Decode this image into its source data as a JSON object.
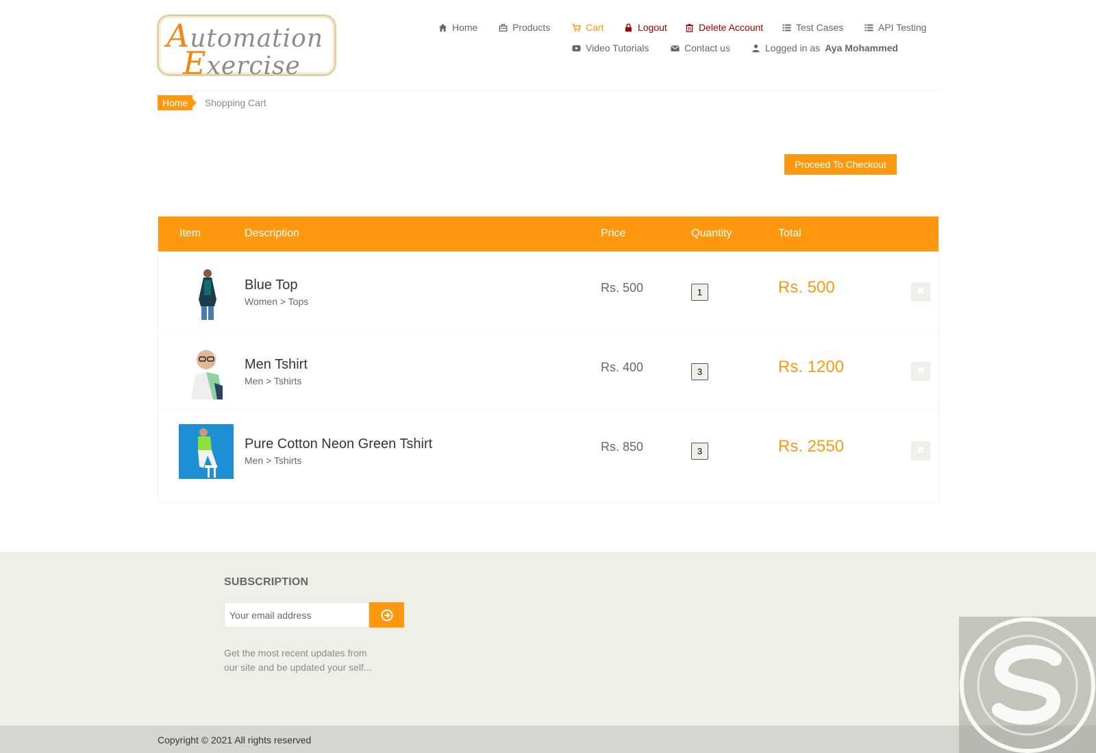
{
  "logo": {
    "line1_cap": "A",
    "line1_rest": "utomation",
    "line2_cap": "E",
    "line2_rest": "xercise"
  },
  "nav": {
    "home": "Home",
    "products": "Products",
    "cart": "Cart",
    "logout": "Logout",
    "delete_account": "Delete Account",
    "test_cases": "Test Cases",
    "api_testing": "API Testing",
    "video_tutorials": "Video Tutorials",
    "contact_us": "Contact us",
    "logged_in_prefix": "Logged in as",
    "logged_in_user": "Aya Mohammed"
  },
  "breadcrumb": {
    "home": "Home",
    "current": "Shopping Cart"
  },
  "checkout_button": "Proceed To Checkout",
  "cart": {
    "headers": {
      "item": "Item",
      "description": "Description",
      "price": "Price",
      "quantity": "Quantity",
      "total": "Total"
    },
    "rows": [
      {
        "name": "Blue Top",
        "category": "Women > Tops",
        "price": "Rs. 500",
        "quantity": "1",
        "total": "Rs. 500"
      },
      {
        "name": "Men Tshirt",
        "category": "Men > Tshirts",
        "price": "Rs. 400",
        "quantity": "3",
        "total": "Rs. 1200"
      },
      {
        "name": "Pure Cotton Neon Green Tshirt",
        "category": "Men > Tshirts",
        "price": "Rs. 850",
        "quantity": "3",
        "total": "Rs. 2550"
      }
    ],
    "delete_icon": "x-icon"
  },
  "footer": {
    "subscription_title": "SUBSCRIPTION",
    "email_placeholder": "Your email address",
    "subscription_text": "Get the most recent updates from our site and be updated your self...",
    "copyright": "Copyright © 2021 All rights reserved"
  },
  "colors": {
    "accent": "#FE980F",
    "logout_red": "#A30000",
    "footer_bg": "#EFEFE8"
  }
}
